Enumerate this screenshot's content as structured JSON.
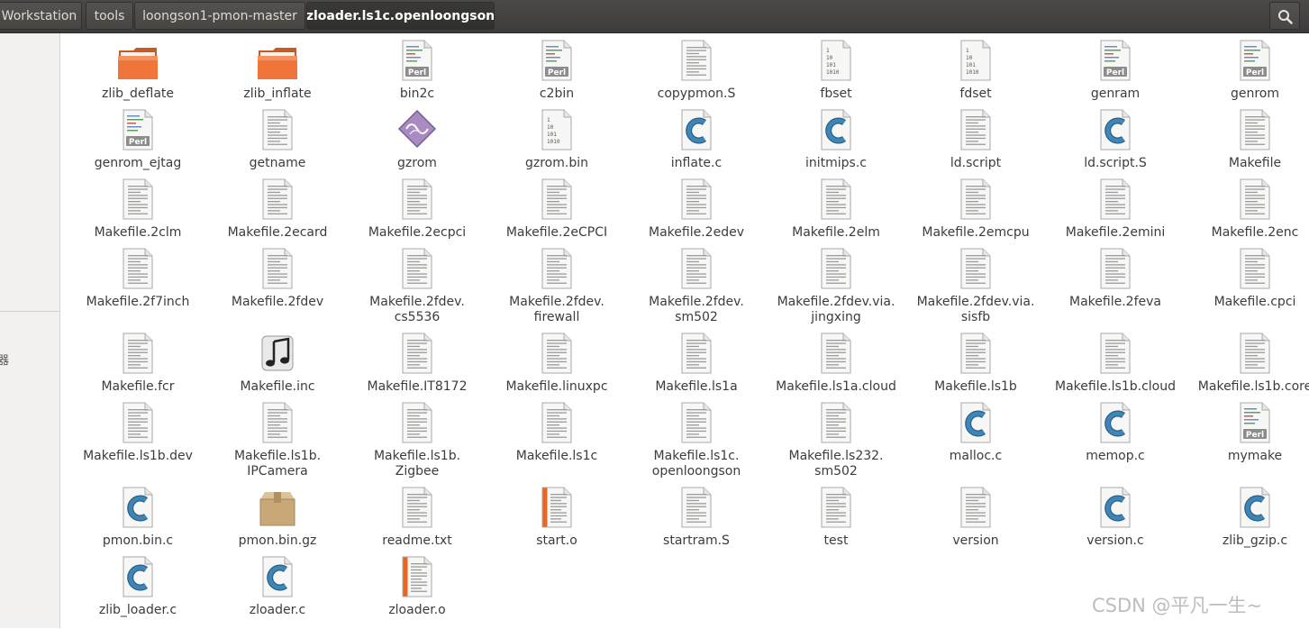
{
  "breadcrumb": {
    "items": [
      {
        "label": "Workstation"
      },
      {
        "label": "tools"
      },
      {
        "label": "loongson1-pmon-master"
      },
      {
        "label": "zloader.ls1c.openloongson"
      }
    ],
    "search_icon": "search-icon"
  },
  "sidebar": {
    "glyph": "器"
  },
  "files": [
    {
      "name": "zlib_deflate",
      "type": "folder"
    },
    {
      "name": "zlib_inflate",
      "type": "folder"
    },
    {
      "name": "bin2c",
      "type": "perl"
    },
    {
      "name": "c2bin",
      "type": "perl"
    },
    {
      "name": "copypmon.S",
      "type": "text"
    },
    {
      "name": "fbset",
      "type": "binary"
    },
    {
      "name": "fdset",
      "type": "binary"
    },
    {
      "name": "genram",
      "type": "perl"
    },
    {
      "name": "genrom",
      "type": "perl"
    },
    {
      "name": "genrom_ejtag",
      "type": "perl"
    },
    {
      "name": "getname",
      "type": "text"
    },
    {
      "name": "gzrom",
      "type": "diamond"
    },
    {
      "name": "gzrom.bin",
      "type": "binary"
    },
    {
      "name": "inflate.c",
      "type": "c"
    },
    {
      "name": "initmips.c",
      "type": "c"
    },
    {
      "name": "ld.script",
      "type": "text"
    },
    {
      "name": "ld.script.S",
      "type": "c"
    },
    {
      "name": "Makefile",
      "type": "text"
    },
    {
      "name": "Makefile.2clm",
      "type": "text"
    },
    {
      "name": "Makefile.2ecard",
      "type": "text"
    },
    {
      "name": "Makefile.2ecpci",
      "type": "text"
    },
    {
      "name": "Makefile.2eCPCI",
      "type": "text"
    },
    {
      "name": "Makefile.2edev",
      "type": "text"
    },
    {
      "name": "Makefile.2elm",
      "type": "text"
    },
    {
      "name": "Makefile.2emcpu",
      "type": "text"
    },
    {
      "name": "Makefile.2emini",
      "type": "text"
    },
    {
      "name": "Makefile.2enc",
      "type": "text"
    },
    {
      "name": "Makefile.2f7inch",
      "type": "text"
    },
    {
      "name": "Makefile.2fdev",
      "type": "text"
    },
    {
      "name": "Makefile.2fdev.\ncs5536",
      "type": "text"
    },
    {
      "name": "Makefile.2fdev.\nfirewall",
      "type": "text"
    },
    {
      "name": "Makefile.2fdev.\nsm502",
      "type": "text"
    },
    {
      "name": "Makefile.2fdev.via.\njingxing",
      "type": "text"
    },
    {
      "name": "Makefile.2fdev.via.\nsisfb",
      "type": "text"
    },
    {
      "name": "Makefile.2feva",
      "type": "text"
    },
    {
      "name": "Makefile.cpci",
      "type": "text"
    },
    {
      "name": "Makefile.fcr",
      "type": "text"
    },
    {
      "name": "Makefile.inc",
      "type": "music"
    },
    {
      "name": "Makefile.IT8172",
      "type": "text"
    },
    {
      "name": "Makefile.linuxpc",
      "type": "text"
    },
    {
      "name": "Makefile.ls1a",
      "type": "text"
    },
    {
      "name": "Makefile.ls1a.cloud",
      "type": "text"
    },
    {
      "name": "Makefile.ls1b",
      "type": "text"
    },
    {
      "name": "Makefile.ls1b.cloud",
      "type": "text"
    },
    {
      "name": "Makefile.ls1b.core",
      "type": "text"
    },
    {
      "name": "Makefile.ls1b.dev",
      "type": "text"
    },
    {
      "name": "Makefile.ls1b.\nIPCamera",
      "type": "text"
    },
    {
      "name": "Makefile.ls1b.\nZigbee",
      "type": "text"
    },
    {
      "name": "Makefile.ls1c",
      "type": "text"
    },
    {
      "name": "Makefile.ls1c.\nopenloongson",
      "type": "text"
    },
    {
      "name": "Makefile.ls232.\nsm502",
      "type": "text"
    },
    {
      "name": "malloc.c",
      "type": "c"
    },
    {
      "name": "memop.c",
      "type": "c"
    },
    {
      "name": "mymake",
      "type": "perl"
    },
    {
      "name": "pmon.bin.c",
      "type": "c"
    },
    {
      "name": "pmon.bin.gz",
      "type": "archive"
    },
    {
      "name": "readme.txt",
      "type": "text"
    },
    {
      "name": "start.o",
      "type": "object"
    },
    {
      "name": "startram.S",
      "type": "text"
    },
    {
      "name": "test",
      "type": "text"
    },
    {
      "name": "version",
      "type": "text"
    },
    {
      "name": "version.c",
      "type": "c"
    },
    {
      "name": "zlib_gzip.c",
      "type": "c"
    },
    {
      "name": "zlib_loader.c",
      "type": "c"
    },
    {
      "name": "zloader.c",
      "type": "c"
    },
    {
      "name": "zloader.o",
      "type": "object"
    }
  ],
  "watermark": "CSDN @平凡一生~",
  "colors": {
    "folder": "#f0753a",
    "c_accent": "#3f86b8",
    "object_stripe": "#e9661f",
    "path_bar": "#3d3c39"
  }
}
